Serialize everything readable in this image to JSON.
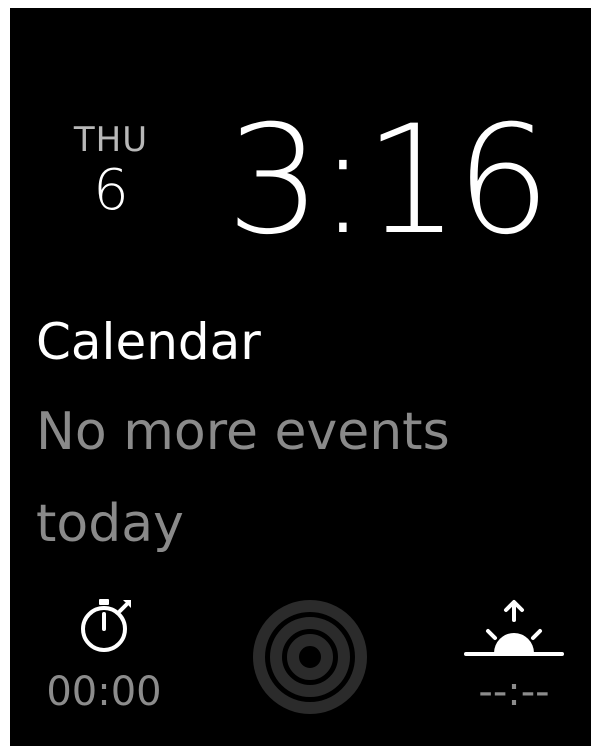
{
  "date": {
    "weekday": "THU",
    "day": "6"
  },
  "time": "3:16",
  "calendar": {
    "title": "Calendar",
    "message": "No more events today"
  },
  "stopwatch": {
    "icon": "stopwatch-icon",
    "value": "00:00"
  },
  "activity": {
    "icon": "activity-rings-icon"
  },
  "sunrise": {
    "icon": "sunrise-icon",
    "value": "--:--"
  },
  "colors": {
    "background": "#000000",
    "primary_text": "#ffffff",
    "secondary_text": "#8a8a8a",
    "activity_rings": "#2a2a2a"
  }
}
